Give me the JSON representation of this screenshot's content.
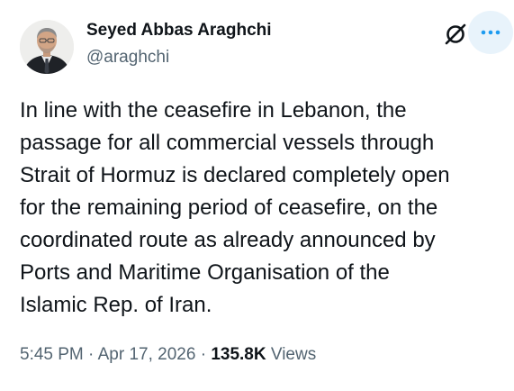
{
  "author": {
    "display_name": "Seyed Abbas Araghchi",
    "handle": "@araghchi",
    "avatar": "profile-photo"
  },
  "header_icons": {
    "grok": "grok-icon",
    "more": "more-horizontal-icon"
  },
  "tweet": {
    "text": "In line with the ceasefire in Lebanon, the\npassage for all commercial vessels through\nStrait of Hormuz is declared completely open\nfor the remaining period of ceasefire, on the\ncoordinated route as already announced by\nPorts and Maritime Organisation of the\nIslamic Rep. of Iran."
  },
  "meta": {
    "time": "5:45 PM",
    "separator": " · ",
    "date": "Apr 17, 2026",
    "views_count": "135.8K",
    "views_label": "Views"
  },
  "colors": {
    "text_primary": "#0f1419",
    "text_secondary": "#536471",
    "accent": "#1d9bf0",
    "more_button_bg": "#e8f3fb"
  }
}
